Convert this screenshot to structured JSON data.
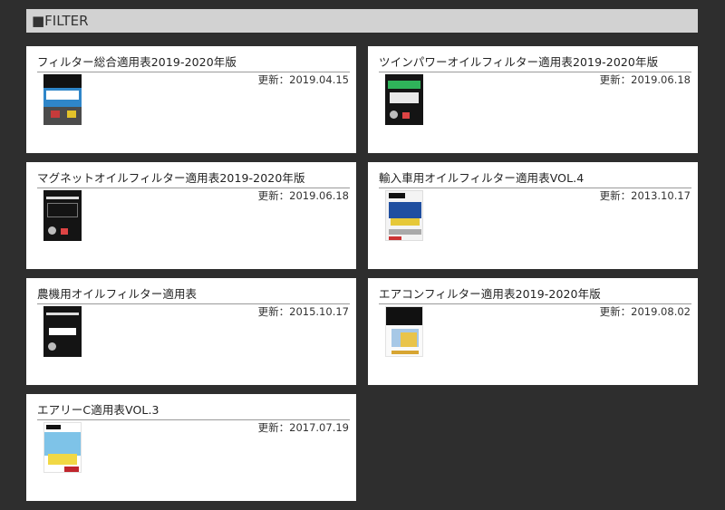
{
  "header": {
    "title": "■FILTER"
  },
  "cards": [
    {
      "title": "フィルター総合適用表2019-2020年版",
      "date": "更新：2019.04.15",
      "thumb": "blue"
    },
    {
      "title": "ツインパワーオイルフィルター適用表2019-2020年版",
      "date": "更新：2019.06.18",
      "thumb": "black-green"
    },
    {
      "title": "マグネットオイルフィルター適用表2019-2020年版",
      "date": "更新：2019.06.18",
      "thumb": "black"
    },
    {
      "title": "輸入車用オイルフィルター適用表VOL.4",
      "date": "更新：2013.10.17",
      "thumb": "white-blue"
    },
    {
      "title": "農機用オイルフィルター適用表",
      "date": "更新：2015.10.17",
      "thumb": "black-white"
    },
    {
      "title": "エアコンフィルター適用表2019-2020年版",
      "date": "更新：2019.08.02",
      "thumb": "aircon"
    },
    {
      "title": "エアリーC適用表VOL.3",
      "date": "更新：2017.07.19",
      "thumb": "airy"
    }
  ]
}
